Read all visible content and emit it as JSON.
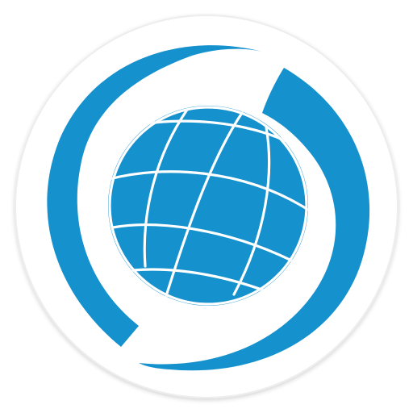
{
  "icon": {
    "name": "globe-app-icon",
    "depicts": "globe-with-orbit-ring",
    "colors": {
      "brand_blue": "#1591CD",
      "background": "#FFFFFF",
      "badge": "#FFFFFF",
      "badge_edge": "#EDEDED"
    }
  }
}
